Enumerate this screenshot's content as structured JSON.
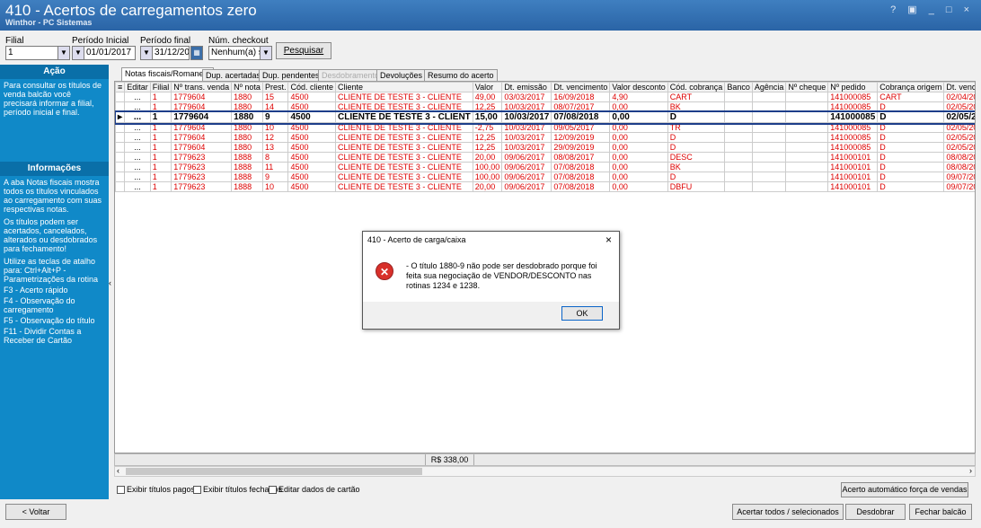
{
  "window": {
    "title": "410 - Acertos de carregamentos zero",
    "subtitle": "Winthor - PC Sistemas",
    "controls": "? ▣ _ □ ×"
  },
  "filters": {
    "filial_label": "Filial",
    "filial_value": "1",
    "periodo_inicial_label": "Período Inicial",
    "periodo_inicial_value": "01/01/2017",
    "periodo_final_label": "Período final",
    "periodo_final_value": "31/12/2017",
    "checkout_label": "Núm. checkout",
    "checkout_value": "Nenhum(a) sele",
    "pesquisar": "Pesquisar"
  },
  "left_panel": {
    "acao_title": "Ação",
    "acao_text": "Para consultar os títulos de venda balcão você precisará informar a filial, período inicial e final.",
    "info_title": "Informações",
    "info_text1": "A aba Notas fiscais mostra todos os títulos vinculados ao carregamento com suas respectivas notas.",
    "info_text2": "Os títulos podem ser acertados, cancelados, alterados ou desdobrados para fechamento!",
    "info_text3": "Utilize as teclas de atalho para: Ctrl+Alt+P - Parametrizações da rotina",
    "info_text4": "F3 - Acerto rápido",
    "info_text5": "F4 - Observação do carregamento",
    "info_text6": "F5 - Observação do título",
    "info_text7": "F11 - Dividir Contas a Receber de Cartão"
  },
  "tabs": [
    "Notas fiscais/Romaneio",
    "Dup. acertadas",
    "Dup. pendentes",
    "Desdobramento",
    "Devoluções",
    "Resumo do acerto"
  ],
  "grid": {
    "headers": [
      "Editar",
      "Filial",
      "Nº trans. venda",
      "Nº nota",
      "Prest.",
      "Cód. cliente",
      "Cliente",
      "Valor",
      "Dt. emissão",
      "Dt. vencimento",
      "Valor desconto",
      "Cód. cobrança",
      "Banco",
      "Agência",
      "Nº cheque",
      "Nº pedido",
      "Cobrança origem",
      "Dt. vencimento origem",
      "Dt. acer"
    ],
    "rows": [
      [
        "...",
        "1",
        "1779604",
        "1880",
        "15",
        "4500",
        "CLIENTE DE TESTE 3 - CLIENTE",
        "49,00",
        "03/03/2017",
        "16/09/2018",
        "4,90",
        "CART",
        "",
        "",
        "",
        "141000085",
        "CART",
        "02/04/2017",
        "21/11/20"
      ],
      [
        "...",
        "1",
        "1779604",
        "1880",
        "14",
        "4500",
        "CLIENTE DE TESTE 3 - CLIENTE",
        "12,25",
        "10/03/2017",
        "08/07/2017",
        "0,00",
        "BK",
        "",
        "",
        "",
        "141000085",
        "D",
        "02/05/2017",
        "21/11/20"
      ],
      [
        "...",
        "1",
        "1779604",
        "1880",
        "9",
        "4500",
        "CLIENTE DE TESTE 3 - CLIENT",
        "15,00",
        "10/03/2017",
        "07/08/2018",
        "0,00",
        "D",
        "",
        "",
        "",
        "141000085",
        "D",
        "02/05/2017",
        " / /"
      ],
      [
        "...",
        "1",
        "1779604",
        "1880",
        "10",
        "4500",
        "CLIENTE DE TESTE 3 - CLIENTE",
        "-2,75",
        "10/03/2017",
        "09/05/2017",
        "0,00",
        "TR",
        "",
        "",
        "",
        "141000085",
        "D",
        "02/05/2017",
        "07/08/20"
      ],
      [
        "...",
        "1",
        "1779604",
        "1880",
        "12",
        "4500",
        "CLIENTE DE TESTE 3 - CLIENTE",
        "12,25",
        "10/03/2017",
        "12/09/2019",
        "0,00",
        "D",
        "",
        "",
        "",
        "141000085",
        "D",
        "02/05/2017",
        "12/09/20"
      ],
      [
        "...",
        "1",
        "1779604",
        "1880",
        "13",
        "4500",
        "CLIENTE DE TESTE 3 - CLIENTE",
        "12,25",
        "10/03/2017",
        "29/09/2019",
        "0,00",
        "D",
        "",
        "",
        "",
        "141000085",
        "D",
        "02/05/2017",
        "12/09/20"
      ],
      [
        "...",
        "1",
        "1779623",
        "1888",
        "8",
        "4500",
        "CLIENTE DE TESTE 3 - CLIENTE",
        "20,00",
        "09/06/2017",
        "08/08/2017",
        "0,00",
        "DESC",
        "",
        "",
        "",
        "141000101",
        "D",
        "08/08/2017",
        "07/08/20"
      ],
      [
        "...",
        "1",
        "1779623",
        "1888",
        "11",
        "4500",
        "CLIENTE DE TESTE 3 - CLIENTE",
        "100,00",
        "09/06/2017",
        "07/08/2018",
        "0,00",
        "BK",
        "",
        "",
        "",
        "141000101",
        "D",
        "08/08/2017",
        "21/11/20"
      ],
      [
        "...",
        "1",
        "1779623",
        "1888",
        "9",
        "4500",
        "CLIENTE DE TESTE 3 - CLIENTE",
        "100,00",
        "09/06/2017",
        "07/08/2018",
        "0,00",
        "D",
        "",
        "",
        "",
        "141000101",
        "D",
        "09/07/2017",
        "21/11/20"
      ],
      [
        "...",
        "1",
        "1779623",
        "1888",
        "10",
        "4500",
        "CLIENTE DE TESTE 3 - CLIENTE",
        "20,00",
        "09/06/2017",
        "07/08/2018",
        "0,00",
        "DBFU",
        "",
        "",
        "",
        "141000101",
        "D",
        "09/07/2017",
        "07/08/20"
      ]
    ],
    "total": "R$ 338,00"
  },
  "checkboxes": [
    "Exibir títulos pagos",
    "Exibir títulos fechados",
    "Editar dados de cartão"
  ],
  "buttons": {
    "acerto_auto": "Acerto automático força de vendas",
    "voltar": "< Voltar",
    "acertar_todos": "Acertar todos / selecionados",
    "desdobrar": "Desdobrar",
    "fechar_balcao": "Fechar balcão"
  },
  "dialog": {
    "title": "410 - Acerto de carga/caixa",
    "close": "×",
    "message": "- O título 1880-9 não pode ser desdobrado porque foi feita sua negociação de VENDOR/DESCONTO nas rotinas 1234 e 1238.",
    "ok": "OK",
    "icon": "error-icon"
  }
}
